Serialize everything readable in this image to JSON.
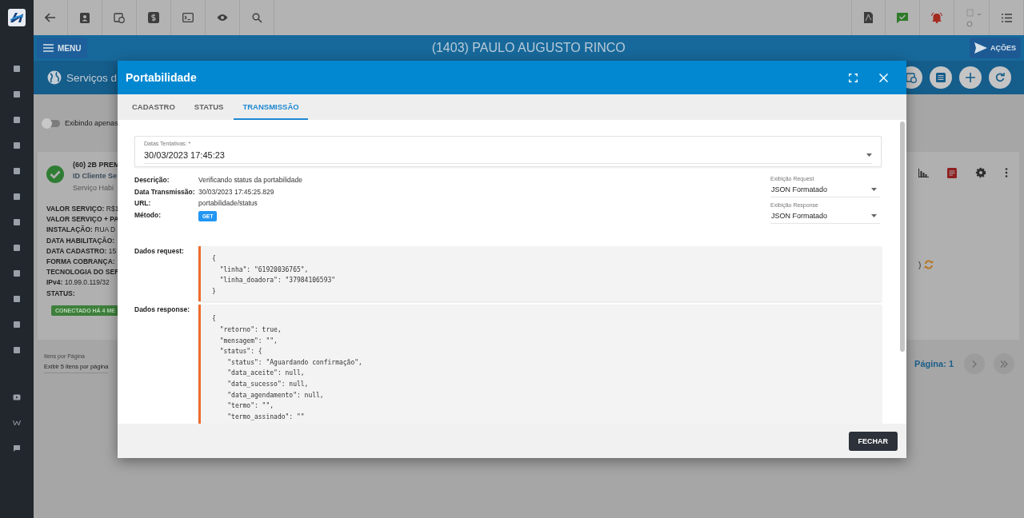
{
  "header": {
    "menu_label": "MENU",
    "title": "(1403) PAULO AUGUSTO RINCO",
    "actions_label": "AÇÕES"
  },
  "page": {
    "title": "Serviços d",
    "toggle": {
      "label": "Exibindo apenas",
      "on": false
    },
    "service_card": {
      "name": "(60) 2B PREM",
      "client_id": "ID Cliente Se",
      "status_text": "Serviço Habi",
      "fields": [
        {
          "label": "VALOR SERVIÇO:",
          "value": "R$1"
        },
        {
          "label": "VALOR SERVIÇO + PA"
        },
        {
          "label": "INSTALAÇÃO:",
          "value": "RUA D"
        },
        {
          "label": "DATA HABILITAÇÃO:"
        },
        {
          "label": "DATA CADASTRO:",
          "value": "15"
        },
        {
          "label": "FORMA COBRANÇA:"
        },
        {
          "label": "TECNOLOGIA DO SER"
        },
        {
          "label": "IPv4:",
          "value": "10.99.0.119/32"
        },
        {
          "label": "STATUS:"
        }
      ],
      "badge": "CONECTADO HÁ 4 ME",
      "trailing_text": ")"
    },
    "pagination": {
      "items_label": "Itens por Página",
      "items_value": "Exibir 5 itens por página",
      "page": "Página: 1"
    }
  },
  "modal": {
    "title": "Portabilidade",
    "tabs": [
      {
        "label": "CADASTRO",
        "selected": false
      },
      {
        "label": "STATUS",
        "selected": false
      },
      {
        "label": "TRANSMISSÃO",
        "selected": true
      }
    ],
    "attempts_select": {
      "label": "Datas Tentativas: *",
      "value": "30/03/2023 17:45:23"
    },
    "details": [
      {
        "kind": "text",
        "label": "Descrição:",
        "value": "Verificando status da portabilidade"
      },
      {
        "kind": "text",
        "label": "Data Transmissão:",
        "value": "30/03/2023 17:45:25.829"
      },
      {
        "kind": "text",
        "label": "URL:",
        "value": "portabilidade/status"
      },
      {
        "kind": "badge",
        "label": "Método:",
        "value": "GET"
      }
    ],
    "display_selects": [
      {
        "label": "Exibição Request",
        "value": "JSON Formatado"
      },
      {
        "label": "Exibição Response",
        "value": "JSON Formatado"
      }
    ],
    "request": {
      "label": "Dados request:",
      "lines": [
        "{",
        "  \"linha\": \"61920036765\",",
        "  \"linha_doadora\": \"37984106593\"",
        "}"
      ]
    },
    "response": {
      "label": "Dados response:",
      "lines": [
        "{",
        "  \"retorno\": true,",
        "  \"mensagem\": \"\",",
        "  \"status\": {",
        "    \"status\": \"Aguardando confirmação\",",
        "    \"data_aceite\": null,",
        "    \"data_sucesso\": null,",
        "    \"data_agendamento\": null,",
        "    \"termo\": \"\",",
        "    \"termo_assinado\": \"\""
      ]
    },
    "close_label": "FECHAR"
  }
}
